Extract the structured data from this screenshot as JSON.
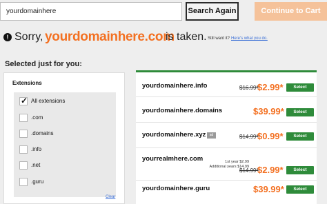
{
  "search": {
    "value": "yourdomainhere",
    "button_label": "Search Again",
    "cart_label": "Continue to Cart"
  },
  "taken": {
    "sorry": "Sorry,",
    "domain": "yourdomainhere.com",
    "is_taken": "is taken.",
    "still_want": "Still want it?",
    "link": "Here's what you do."
  },
  "selected_title": "Selected just for you:",
  "filters": {
    "title": "Extensions",
    "items": [
      {
        "label": "All extensions",
        "checked": true
      },
      {
        "label": ".com",
        "checked": false
      },
      {
        "label": ".domains",
        "checked": false
      },
      {
        "label": ".info",
        "checked": false
      },
      {
        "label": ".net",
        "checked": false
      },
      {
        "label": ".guru",
        "checked": false
      }
    ],
    "clear": "Clear"
  },
  "results": [
    {
      "domain": "yourdomainhere.info",
      "old_price": "$16.99*",
      "price": "$2.99*",
      "select": "Select"
    },
    {
      "domain": "yourdomainhere.domains",
      "old_price": "",
      "price": "$39.99*",
      "select": "Select"
    },
    {
      "domain": "yourdomainhere.xyz",
      "badge": "ad",
      "old_price": "$14.99*",
      "price": "$0.99*",
      "select": "Select"
    },
    {
      "domain": "yourrealmhere.com",
      "note1": "1st year $2.99",
      "note2": "Additional years $14.99",
      "old_price": "$14.99*",
      "price": "$2.99*",
      "select": "Select"
    },
    {
      "domain": "yourdomainhere.guru",
      "old_price": "",
      "price": "$39.99*",
      "select": "Select"
    }
  ],
  "colors": {
    "accent_orange": "#f37021",
    "select_green": "#2e8b3a",
    "cart_button": "#f5c29a",
    "link_blue": "#3b6fd6"
  }
}
